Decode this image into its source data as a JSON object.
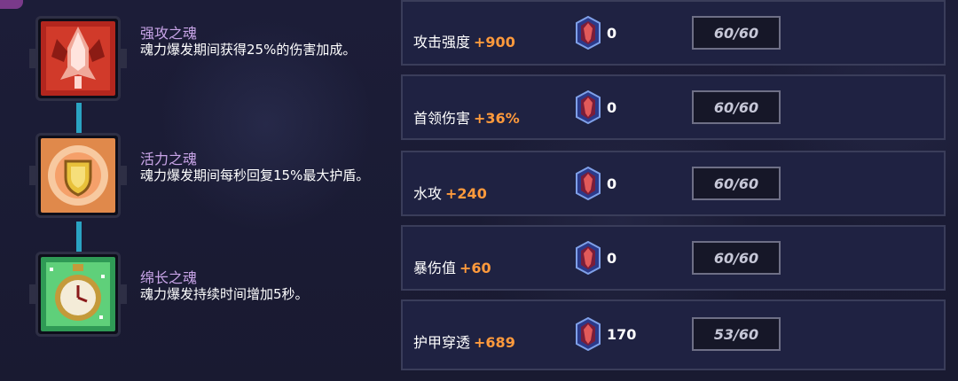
{
  "souls": [
    {
      "name": "强攻之魂",
      "description": "魂力爆发期间获得25%的伤害加成。",
      "icon": "red-bomb-icon"
    },
    {
      "name": "活力之魂",
      "description": "魂力爆发期间每秒回复15%最大护盾。",
      "icon": "shield-icon"
    },
    {
      "name": "绵长之魂",
      "description": "魂力爆发持续时间增加5秒。",
      "icon": "pocket-watch-icon"
    }
  ],
  "stats": [
    {
      "label": "攻击强度",
      "bonus": "+900",
      "gem_count": "0",
      "level": "60/60"
    },
    {
      "label": "首领伤害",
      "bonus": "+36%",
      "gem_count": "0",
      "level": "60/60"
    },
    {
      "label": "水攻",
      "bonus": "+240",
      "gem_count": "0",
      "level": "60/60"
    },
    {
      "label": "暴伤值",
      "bonus": "+60",
      "gem_count": "0",
      "level": "60/60"
    },
    {
      "label": "护甲穿透",
      "bonus": "+689",
      "gem_count": "170",
      "level": "53/60"
    }
  ],
  "colors": {
    "soul_name": "#c9a5e8",
    "bonus": "#ff9a3c",
    "connector": "#2aa3c2"
  }
}
